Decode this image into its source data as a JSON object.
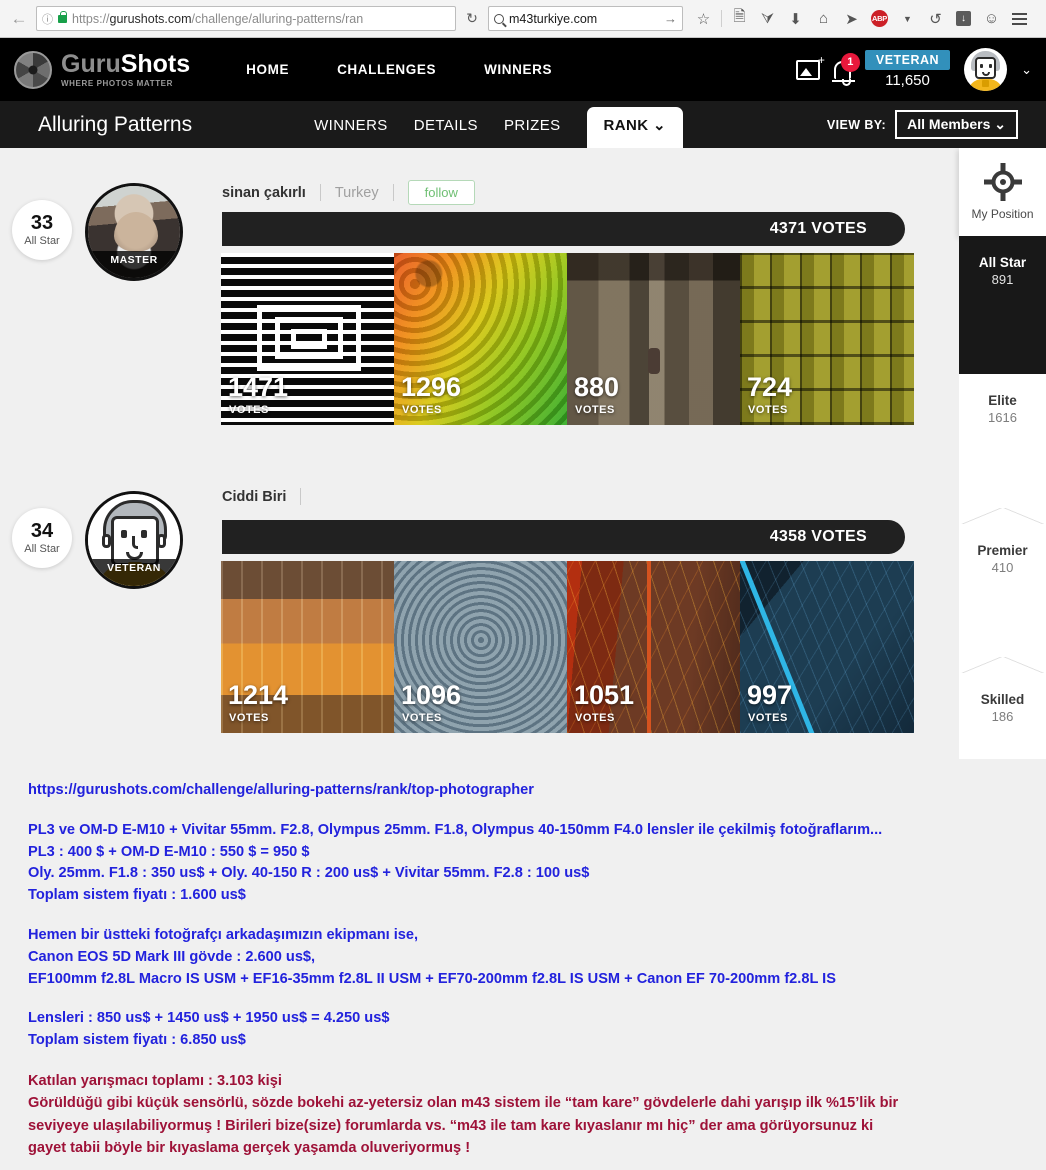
{
  "browser": {
    "back_icon": "back-arrow-icon",
    "info_icon": "info-icon",
    "lock_icon": "lock-icon",
    "url_prefix": "https://",
    "url_domain": "gurushots.com",
    "url_path": "/challenge/alluring-patterns/ran",
    "reload_label": "↻",
    "search_value": "m43turkiye.com",
    "search_go": "→",
    "toolbar_icons": [
      "star-icon",
      "reader-icon",
      "shield-icon",
      "download-icon",
      "home-icon",
      "pocket-icon",
      "adblock-icon",
      "chevron-down-icon",
      "history-icon",
      "downloads-icon",
      "smiley-icon",
      "hamburger-menu-icon"
    ],
    "adblock_label": "ABP"
  },
  "header": {
    "logo_icon": "aperture-icon",
    "brand_first": "Guru",
    "brand_second": "Shots",
    "tagline": "WHERE PHOTOS MATTER",
    "nav": [
      {
        "label": "HOME"
      },
      {
        "label": "CHALLENGES"
      },
      {
        "label": "WINNERS"
      }
    ],
    "upload_icon": "add-photo-icon",
    "bell_icon": "notification-bell-icon",
    "notification_count": "1",
    "rank_label": "VETERAN",
    "points": "11,650",
    "avatar_icon": "user-avatar-icon",
    "account_caret": "⌄"
  },
  "challenge": {
    "title": "Alluring Patterns",
    "tabs": [
      {
        "label": "WINNERS",
        "active": false
      },
      {
        "label": "DETAILS",
        "active": false
      },
      {
        "label": "PRIZES",
        "active": false
      },
      {
        "label": "RANK ⌄",
        "active": true
      }
    ],
    "view_by_label": "VIEW BY:",
    "view_by_value": "All Members ⌄"
  },
  "entries": [
    {
      "rank": "33",
      "tier": "All Star",
      "username": "sinan çakırlı",
      "country": "Turkey",
      "follow_label": "follow",
      "badge_title": "MASTER",
      "total_votes": "4371 VOTES",
      "photos": [
        {
          "votes": "1471",
          "votes_label": "VOTES",
          "art": "art-spiral"
        },
        {
          "votes": "1296",
          "votes_label": "VOTES",
          "art": "art-straws"
        },
        {
          "votes": "880",
          "votes_label": "VOTES",
          "art": "art-corridor"
        },
        {
          "votes": "724",
          "votes_label": "VOTES",
          "art": "art-tiles"
        }
      ]
    },
    {
      "rank": "34",
      "tier": "All Star",
      "username": "Ciddi Biri",
      "country": "",
      "follow_label": "",
      "badge_title": "VETERAN",
      "total_votes": "4358 VOTES",
      "photos": [
        {
          "votes": "1214",
          "votes_label": "VOTES",
          "art": "art-brush"
        },
        {
          "votes": "1096",
          "votes_label": "VOTES",
          "art": "art-ripple"
        },
        {
          "votes": "1051",
          "votes_label": "VOTES",
          "art": "art-leafred"
        },
        {
          "votes": "997",
          "votes_label": "VOTES",
          "art": "art-leafblue"
        }
      ]
    }
  ],
  "sidebar": {
    "my_position_icon": "target-crosshair-icon",
    "my_position_label": "My Position",
    "tiers": [
      {
        "name": "All Star",
        "count": "891",
        "active": true
      },
      {
        "name": "Elite",
        "count": "1616",
        "active": false
      },
      {
        "name": "Premier",
        "count": "410",
        "active": false
      },
      {
        "name": "Skilled",
        "count": "186",
        "active": false
      }
    ]
  },
  "notes": {
    "link": "https://gurushots.com/challenge/alluring-patterns/rank/top-photographer",
    "block1": [
      "PL3 ve OM-D E-M10 + Vivitar 55mm. F2.8, Olympus 25mm. F1.8, Olympus 40-150mm F4.0 lensler ile çekilmiş fotoğraflarım...",
      "PL3 : 400 $ + OM-D E-M10 : 550 $ = 950 $",
      "Oly. 25mm. F1.8 : 350 us$ + Oly. 40-150 R : 200 us$ + Vivitar 55mm. F2.8 : 100 us$",
      "Toplam sistem fiyatı : 1.600 us$"
    ],
    "block2": [
      "Hemen bir üstteki fotoğrafçı arkadaşımızın ekipmanı ise,",
      "Canon EOS 5D Mark III gövde : 2.600 us$,",
      "EF100mm f2.8L Macro IS USM + EF16-35mm f2.8L II USM + EF70-200mm f2.8L IS USM + Canon EF 70-200mm f2.8L IS"
    ],
    "block3": [
      "Lensleri : 850 us$ + 1450 us$ + 1950 us$ = 4.250 us$",
      "Toplam sistem fiyatı : 6.850 us$"
    ],
    "block4": [
      "Katılan yarışmacı toplamı : 3.103  kişi",
      "Görüldüğü gibi küçük sensörlü, sözde bokehi az-yetersiz olan m43 sistem ile “tam kare” gövdelerle dahi yarışıp ilk %15’lik bir",
      "seviyeye ulaşılabiliyormuş ! Birileri bize(size) forumlarda vs. “m43 ile tam kare kıyaslanır mı hiç” der ama görüyorsunuz ki",
      "gayet tabii böyle bir kıyaslama gerçek yaşamda oluveriyormuş !"
    ]
  },
  "colors": {
    "accent_blue": "#3290bb",
    "link_blue": "#2222dd",
    "note_red": "#9e1238",
    "badge_red": "#e8183c",
    "follow_green": "#6fbf73"
  }
}
